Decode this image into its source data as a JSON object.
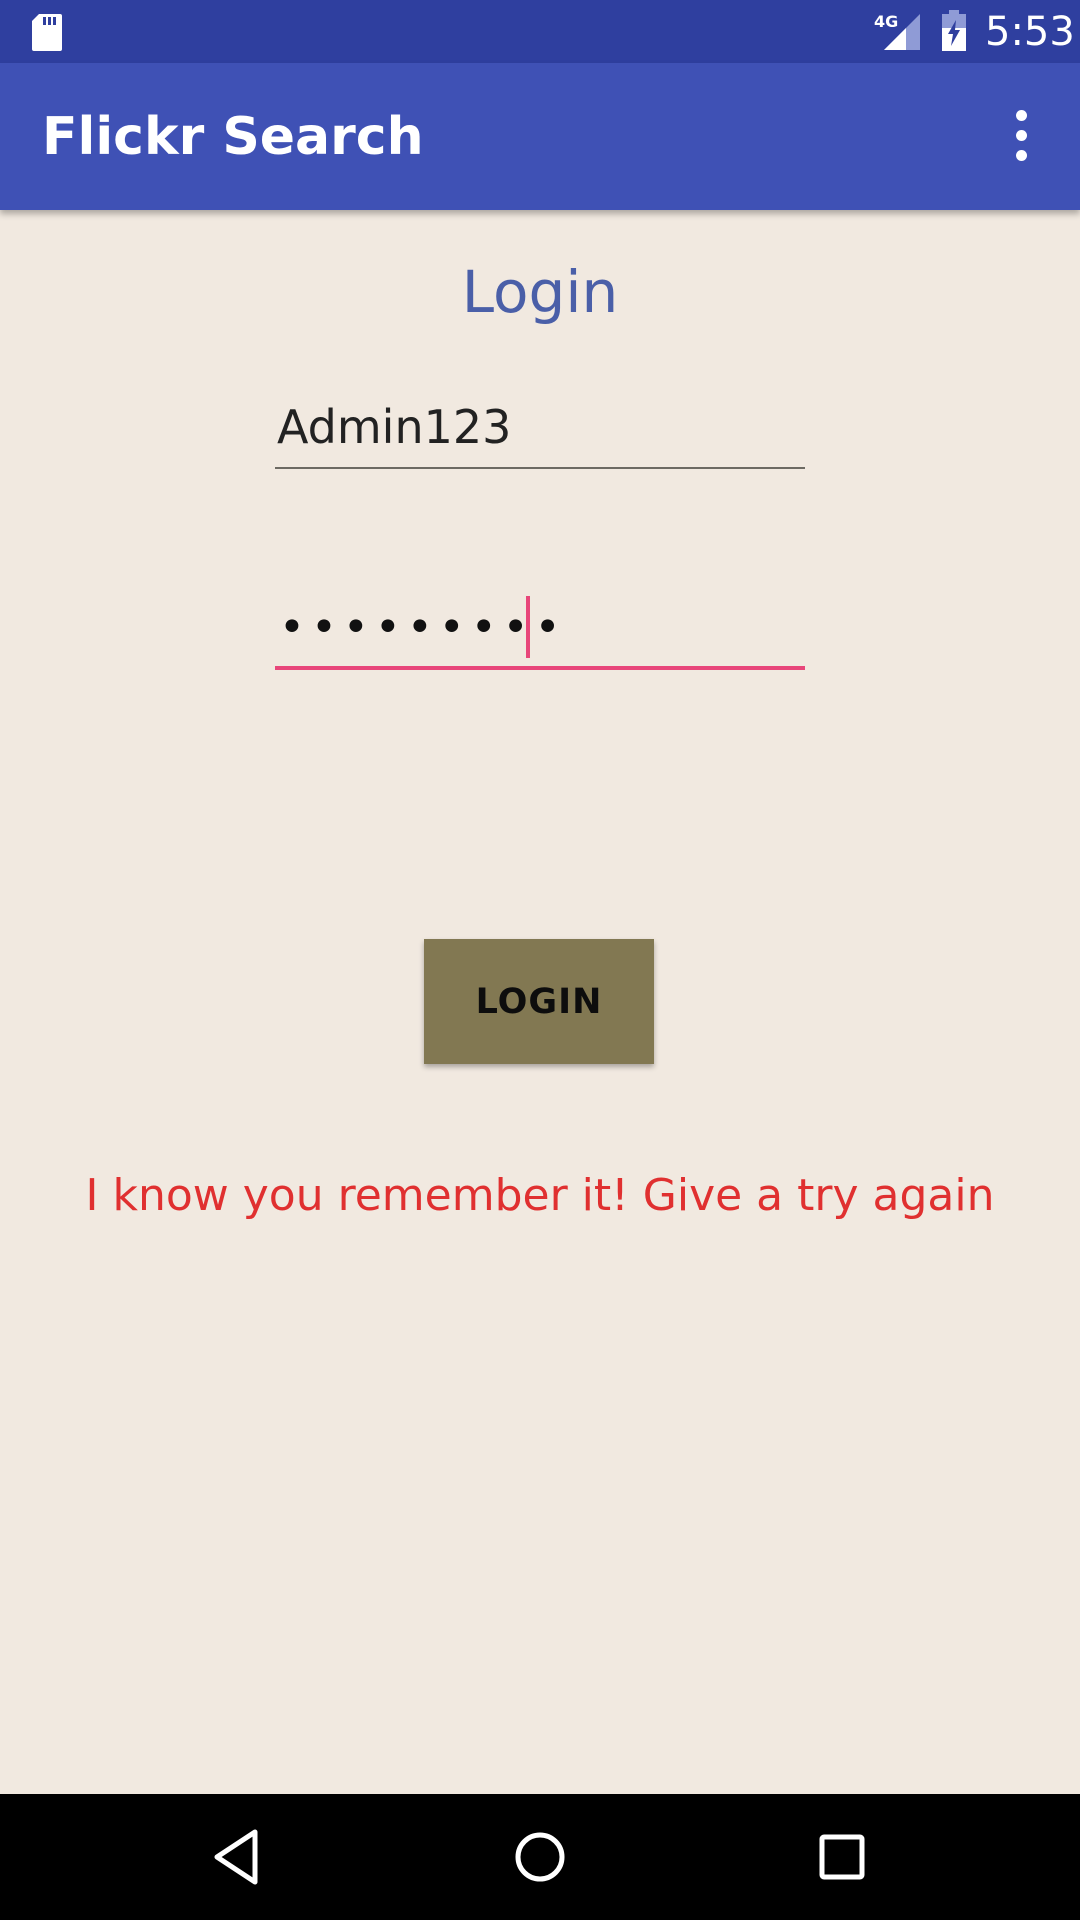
{
  "status_bar": {
    "time": "5:53",
    "network_label": "4G",
    "icons": [
      "sd-card-icon",
      "signal-4g-icon",
      "battery-charging-icon"
    ]
  },
  "app_bar": {
    "title": "Flickr Search",
    "menu_icon": "overflow-menu-icon"
  },
  "login": {
    "heading": "Login",
    "username_value": "Admin123",
    "password_masked": "•••••••••",
    "button_label": "LOGIN",
    "error_message": "I know you remember it! Give a try again"
  },
  "nav_bar": {
    "icons": [
      "back-icon",
      "home-icon",
      "recents-icon"
    ]
  },
  "colors": {
    "status_bar": "#2f3f9f",
    "app_bar": "#3f51b5",
    "background": "#f1e9e0",
    "heading": "#4a5fa8",
    "field_underline": "#6d6a63",
    "field_focus": "#e8467a",
    "button": "#827852",
    "error": "#e03030",
    "nav_bar": "#000000"
  }
}
